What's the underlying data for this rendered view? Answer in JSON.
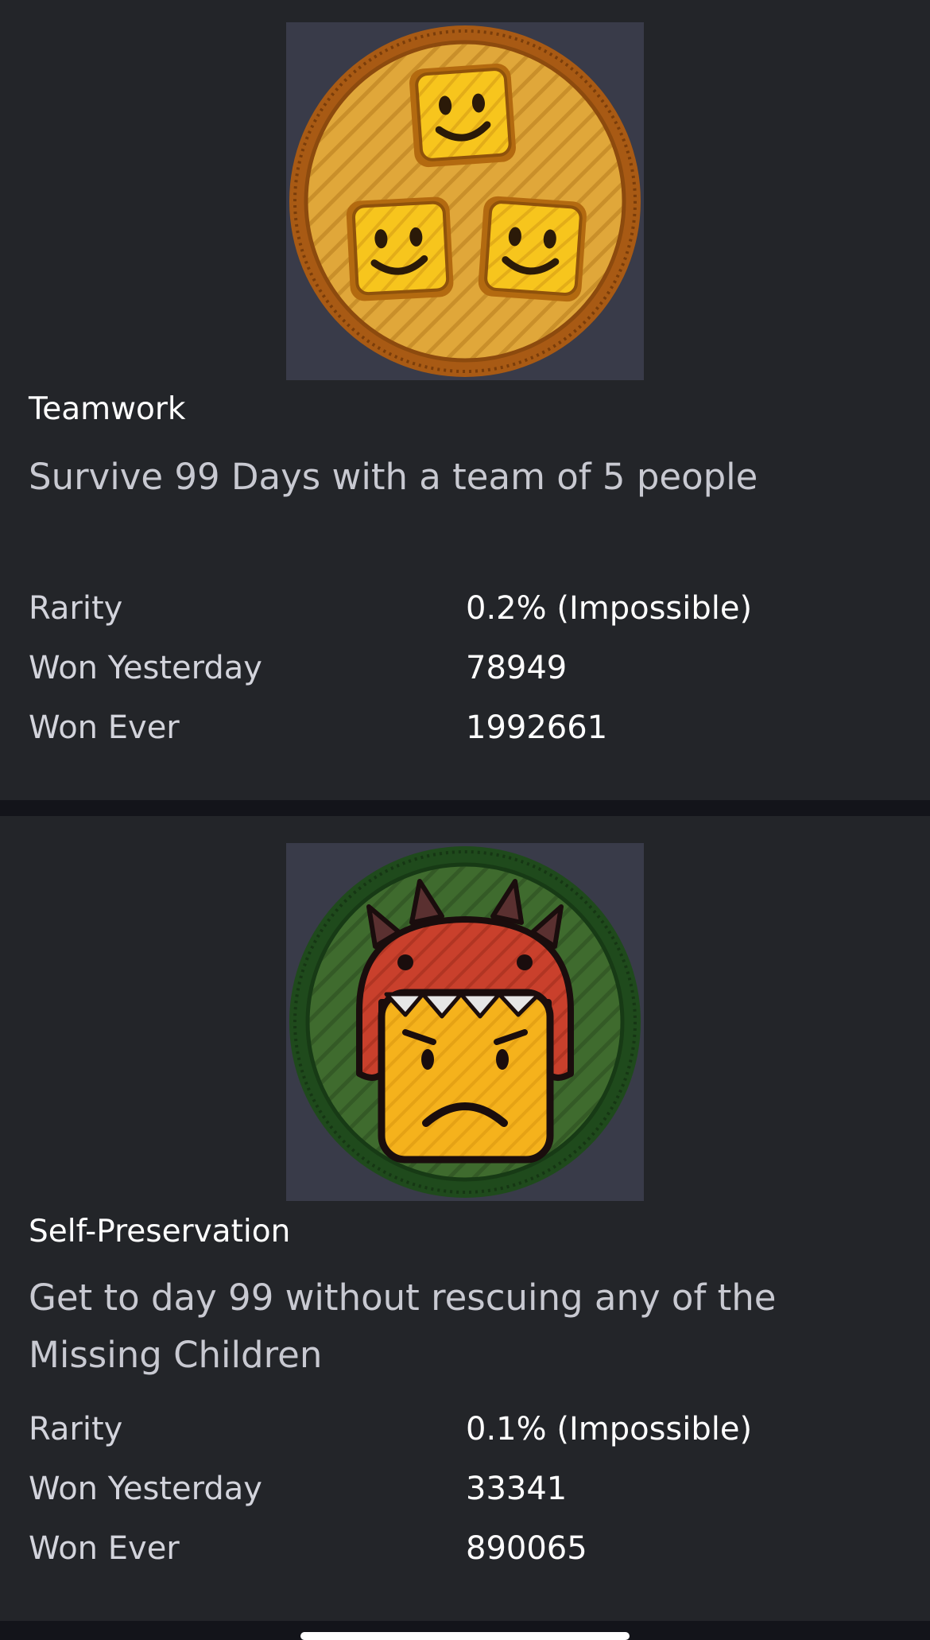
{
  "badges": [
    {
      "title": "Teamwork",
      "description": "Survive 99 Days with a team of 5 people",
      "icon": "teamwork-badge-icon",
      "ring_color": "#a85a14",
      "fill_color": "#e0a73a",
      "stats": [
        {
          "label": "Rarity",
          "value": "0.2% (Impossible)"
        },
        {
          "label": "Won Yesterday",
          "value": "78949"
        },
        {
          "label": "Won Ever",
          "value": "1992661"
        }
      ]
    },
    {
      "title": "Self-Preservation",
      "description": "Get to day 99 without rescuing any of the Missing Children",
      "icon": "self-preservation-badge-icon",
      "ring_color": "#1f4a1c",
      "fill_color": "#3f6b2e",
      "stats": [
        {
          "label": "Rarity",
          "value": "0.1% (Impossible)"
        },
        {
          "label": "Won Yesterday",
          "value": "33341"
        },
        {
          "label": "Won Ever",
          "value": "890065"
        }
      ]
    }
  ],
  "colors": {
    "background": "#13141a",
    "card": "#232529",
    "badge_frame": "#393b49",
    "text_primary": "#ffffff",
    "text_secondary": "#c8c9d1"
  }
}
